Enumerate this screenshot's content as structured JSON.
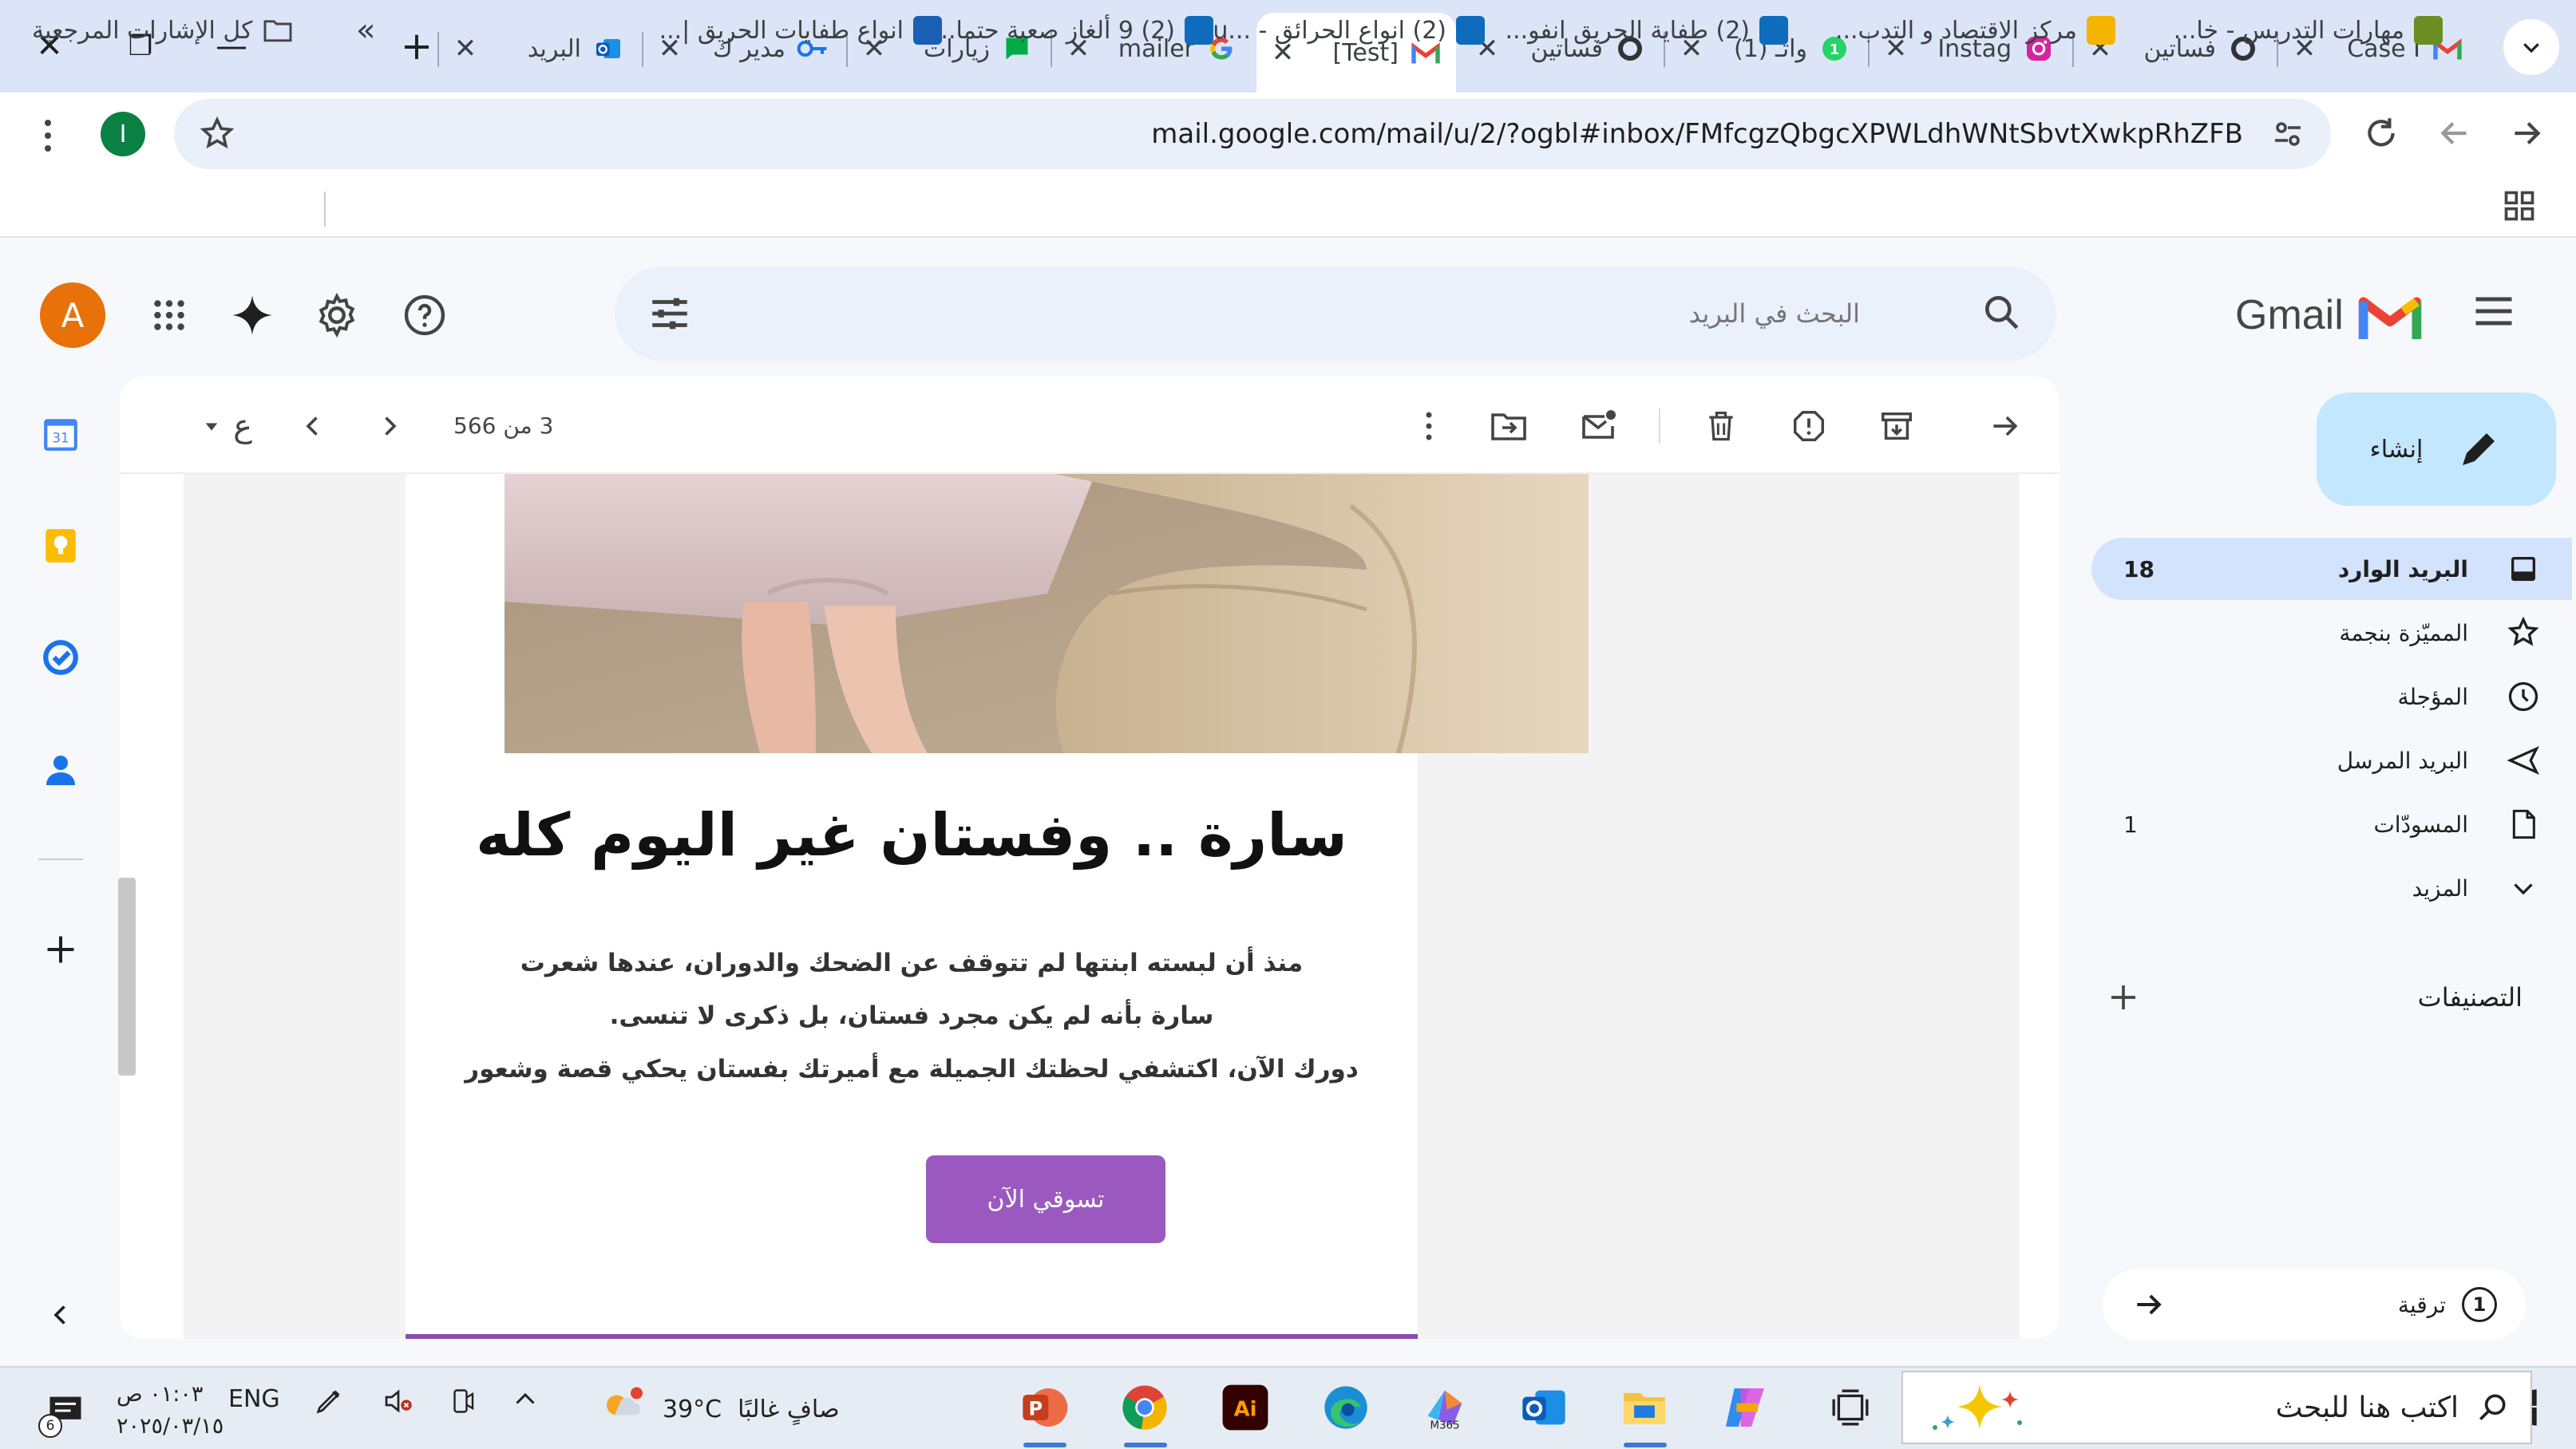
{
  "browser": {
    "tabs": [
      {
        "title": "Case I",
        "fav": "gmail"
      },
      {
        "title": "فساتين",
        "fav": "circle"
      },
      {
        "title": "Instag",
        "fav": "instagram"
      },
      {
        "title": "(1) واتـ",
        "fav": "whatsapp"
      },
      {
        "title": "فساتين",
        "fav": "circle"
      },
      {
        "title": "[Test]",
        "fav": "gmail",
        "active": true
      },
      {
        "title": "mailer",
        "fav": "google"
      },
      {
        "title": "زيارات",
        "fav": "chat"
      },
      {
        "title": "مدير ك",
        "fav": "key"
      },
      {
        "title": "البريد",
        "fav": "outlook"
      }
    ],
    "new_tab": "+",
    "close": "✕",
    "restore": "❐",
    "minimize": "—",
    "url": "mail.google.com/mail/u/2/?ogbl#inbox/FMfcgzQbgcXPWLdhWNtSbvtXwkpRhZFB",
    "profile_letter": "I",
    "bookmarks": [
      {
        "label": "مهارات التدريس - خا...",
        "color": "#6b8e23"
      },
      {
        "label": "مركز الاقتصاد و التدب...",
        "color": "#f5b400"
      },
      {
        "label": "(2) طفاية الحريق انفو...",
        "color": "#0f6cbd"
      },
      {
        "label": "(2) انواع الحرائق - ...You",
        "color": "#0f6cbd"
      },
      {
        "label": "(2) 9 ألغاز صعبة حتما...",
        "color": "#0f6cbd"
      },
      {
        "label": "انواع طفايات الحريق |...",
        "color": "#1a5fb4"
      }
    ],
    "bookmarks_more": "»",
    "all_bookmarks": "كل الإشارات المرجعية"
  },
  "gmail": {
    "logo_text": "Gmail",
    "search_placeholder": "البحث في البريد",
    "avatar_letter": "A",
    "compose": "إنشاء",
    "nav": [
      {
        "label": "البريد الوارد",
        "count": "18",
        "icon": "inbox-icon",
        "selected": true
      },
      {
        "label": "المميّزة بنجمة",
        "count": "",
        "icon": "star-icon"
      },
      {
        "label": "المؤجلة",
        "count": "",
        "icon": "clock-icon"
      },
      {
        "label": "البريد المرسل",
        "count": "",
        "icon": "send-icon"
      },
      {
        "label": "المسودّات",
        "count": "1",
        "icon": "draft-icon"
      },
      {
        "label": "المزيد",
        "count": "",
        "icon": "chevron-down-icon"
      }
    ],
    "labels_header": "التصنيفات",
    "upgrade": "ترقية",
    "upgrade_badge": "1",
    "page_info": "3 من 566",
    "lang_toggle": "ع"
  },
  "email": {
    "headline": "سارة .. وفستان غير اليوم كله",
    "para1": "منذ أن لبسته ابنتها لم تتوقف عن الضحك والدوران، عندها شعرت سارة بأنه لم يكن مجرد فستان، بل ذكرى لا تنسى.",
    "para2": "دورك الآن، اكتشفي لحظتك الجميلة مع أميرتك بفستان يحكي قصة وشعور",
    "button": "تسوقي الآن"
  },
  "taskbar": {
    "search_placeholder": "اكتب هنا للبحث",
    "weather_text": "صافٍ غالبًا",
    "temperature": "39°C",
    "lang": "ENG",
    "time": "٠١:٠٣ ص",
    "date": "٢٠٢٥/٠٣/١٥",
    "notif_count": "6"
  }
}
